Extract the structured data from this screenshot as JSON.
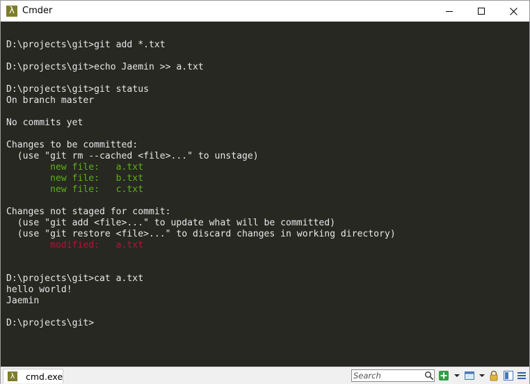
{
  "window": {
    "title": "Cmder"
  },
  "console": {
    "lines": [
      {
        "text": "D:\\projects\\git>git add *.txt",
        "color": "#e8e8e8"
      },
      {
        "text": "",
        "color": "#e8e8e8"
      },
      {
        "text": "D:\\projects\\git>echo Jaemin >> a.txt",
        "color": "#e8e8e8"
      },
      {
        "text": "",
        "color": "#e8e8e8"
      },
      {
        "text": "D:\\projects\\git>git status",
        "color": "#e8e8e8"
      },
      {
        "text": "On branch master",
        "color": "#e8e8e8"
      },
      {
        "text": "",
        "color": "#e8e8e8"
      },
      {
        "text": "No commits yet",
        "color": "#e8e8e8"
      },
      {
        "text": "",
        "color": "#e8e8e8"
      },
      {
        "text": "Changes to be committed:",
        "color": "#e8e8e8"
      },
      {
        "text": "  (use \"git rm --cached <file>...\" to unstage)",
        "color": "#e8e8e8"
      },
      {
        "text": "        new file:   a.txt",
        "color": "#5fae1d"
      },
      {
        "text": "        new file:   b.txt",
        "color": "#5fae1d"
      },
      {
        "text": "        new file:   c.txt",
        "color": "#5fae1d"
      },
      {
        "text": "",
        "color": "#e8e8e8"
      },
      {
        "text": "Changes not staged for commit:",
        "color": "#e8e8e8"
      },
      {
        "text": "  (use \"git add <file>...\" to update what will be committed)",
        "color": "#e8e8e8"
      },
      {
        "text": "  (use \"git restore <file>...\" to discard changes in working directory)",
        "color": "#e8e8e8"
      },
      {
        "text": "        modified:   a.txt",
        "color": "#b81036"
      },
      {
        "text": "",
        "color": "#e8e8e8"
      },
      {
        "text": "",
        "color": "#e8e8e8"
      },
      {
        "text": "D:\\projects\\git>cat a.txt",
        "color": "#e8e8e8"
      },
      {
        "text": "hello world!",
        "color": "#e8e8e8"
      },
      {
        "text": "Jaemin",
        "color": "#e8e8e8"
      },
      {
        "text": "",
        "color": "#e8e8e8"
      },
      {
        "text": "D:\\projects\\git>",
        "color": "#e8e8e8"
      }
    ]
  },
  "statusbar": {
    "tab_label": "cmd.exe",
    "search_placeholder": "Search",
    "icons": [
      "search-icon",
      "new-console-plus-icon",
      "dropdown-arrow-icon",
      "window-icon",
      "dropdown-arrow-icon",
      "lock-icon",
      "split-view-icon",
      "menu-list-icon"
    ]
  },
  "colors": {
    "console_bg": "#272822",
    "console_fg": "#e8e8e8",
    "staged": "#5fae1d",
    "modified": "#b81036",
    "app_icon": "#7d7d2c"
  }
}
